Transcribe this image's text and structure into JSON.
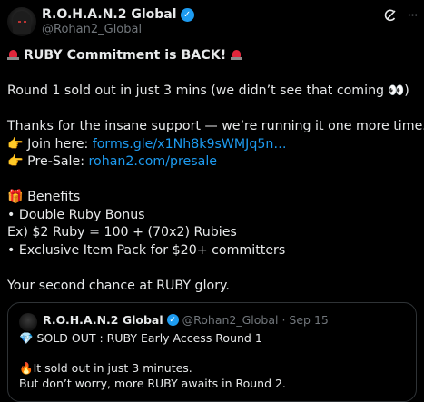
{
  "author": {
    "name": "R.O.H.A.N.2 Global",
    "handle": "@Rohan2_Global"
  },
  "icons": {
    "verified": "verified-badge-icon",
    "grok": "grok-icon",
    "more": "more-icon"
  },
  "tweet": {
    "headline": "RUBY Commitment is BACK!",
    "line_round": "Round 1 sold out in just 3 mins (we didn’t see that coming ",
    "line_round_emoji": "👀",
    "line_round_end": ")",
    "line_thanks": "Thanks for the insane support — we’re running it one more time.",
    "join_emoji": "👉",
    "join_label": " Join here: ",
    "join_link": "forms.gle/x1Nh8k9sWMJq5n…",
    "presale_emoji": "👉",
    "presale_label": " Pre-Sale: ",
    "presale_link": "rohan2.com/presale",
    "benefits_emoji": "🎁",
    "benefits_label": " Benefits",
    "benefit_1": "• Double Ruby Bonus",
    "benefit_2": "Ex) $2 Ruby = 100 + (70x2) Rubies",
    "benefit_3": "• Exclusive Item Pack for $20+ committers",
    "closing": "Your second chance at RUBY glory."
  },
  "quote": {
    "name": "R.O.H.A.N.2 Global",
    "meta": "@Rohan2_Global · Sep 15",
    "gem_emoji": "💎",
    "line_1": " SOLD OUT :  RUBY Early Access Round 1",
    "fire_emoji": "🔥",
    "line_2": "It sold out in just 3 minutes.",
    "line_3": "But don’t worry, more RUBY awaits in Round 2."
  }
}
